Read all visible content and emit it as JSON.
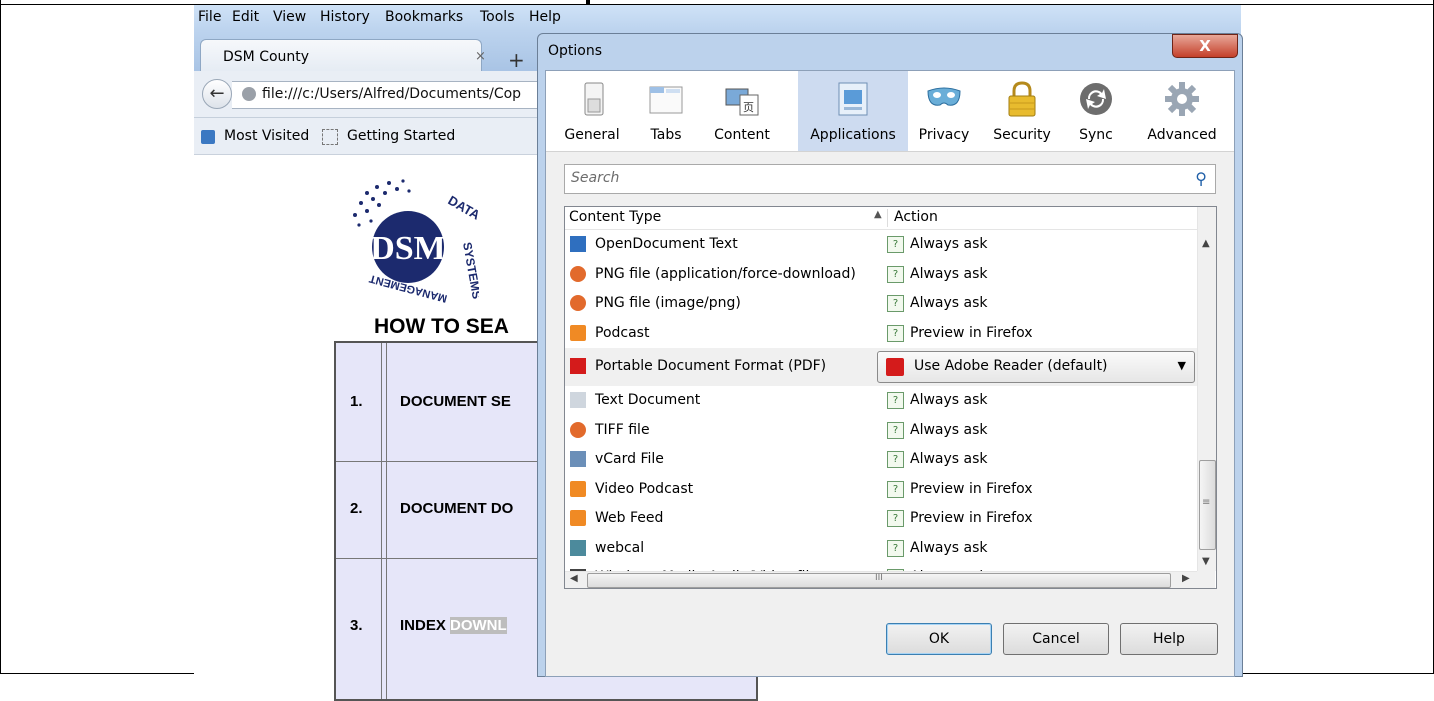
{
  "menubar": {
    "items": [
      "File",
      "Edit",
      "View",
      "History",
      "Bookmarks",
      "Tools",
      "Help"
    ]
  },
  "tab": {
    "title": "DSM County",
    "close": "×",
    "new": "+"
  },
  "navbar": {
    "back": "←",
    "url": "file:///c:/Users/Alfred/Documents/Cop"
  },
  "bookmarks": {
    "most_visited": "Most Visited",
    "getting_started": "Getting Started"
  },
  "page": {
    "heading": "HOW TO SEA",
    "steps": [
      {
        "num": "1.",
        "text": "DOCUMENT SE"
      },
      {
        "num": "2.",
        "text": "DOCUMENT DO"
      },
      {
        "num": "3.",
        "text_a": "INDEX ",
        "text_b": "DOWNL"
      }
    ]
  },
  "dialog": {
    "title": "Options",
    "close": "X",
    "toolbar": [
      {
        "label": "General",
        "icon": "switch-icon"
      },
      {
        "label": "Tabs",
        "icon": "tabs-icon"
      },
      {
        "label": "Content",
        "icon": "content-icon"
      },
      {
        "label": "Applications",
        "icon": "applications-icon"
      },
      {
        "label": "Privacy",
        "icon": "mask-icon"
      },
      {
        "label": "Security",
        "icon": "padlock-icon"
      },
      {
        "label": "Sync",
        "icon": "sync-icon"
      },
      {
        "label": "Advanced",
        "icon": "gear-icon"
      }
    ],
    "active_tab": "Applications",
    "search": {
      "placeholder": "Search",
      "icon": "⚲"
    },
    "columns": {
      "content_type": "Content Type",
      "action": "Action",
      "sort_glyph": "▲"
    },
    "rows": [
      {
        "name": "OpenDocument Text",
        "action": "Always ask",
        "icon": "document-icon"
      },
      {
        "name": "PNG file (application/force-download)",
        "action": "Always ask",
        "icon": "image-icon"
      },
      {
        "name": "PNG file (image/png)",
        "action": "Always ask",
        "icon": "image-icon"
      },
      {
        "name": "Podcast",
        "action": "Preview in Firefox",
        "icon": "rss-icon"
      },
      {
        "name": "Portable Document Format (PDF)",
        "action": "Use Adobe Reader  (default)",
        "icon": "pdf-icon",
        "selected": true
      },
      {
        "name": "Text Document",
        "action": "Always ask",
        "icon": "text-file-icon"
      },
      {
        "name": "TIFF file",
        "action": "Always ask",
        "icon": "image-icon"
      },
      {
        "name": "vCard File",
        "action": "Always ask",
        "icon": "vcard-icon"
      },
      {
        "name": "Video Podcast",
        "action": "Preview in Firefox",
        "icon": "rss-icon"
      },
      {
        "name": "Web Feed",
        "action": "Preview in Firefox",
        "icon": "rss-icon"
      },
      {
        "name": "webcal",
        "action": "Always ask",
        "icon": "calendar-icon"
      },
      {
        "name": "Windows Media Audio/Video file",
        "action": "Always ask",
        "icon": "media-icon"
      }
    ],
    "scroll_glyphs": {
      "up": "▲",
      "down": "▼",
      "left": "◀",
      "right": "▶",
      "grip_v": "≡",
      "grip_h": "III"
    },
    "buttons": {
      "ok": "OK",
      "cancel": "Cancel",
      "help": "Help"
    }
  },
  "colors": {
    "active_tab_bg": "#cddbf0",
    "title_bar": "#bcd2ec",
    "close_red": "#c4402a",
    "pdf_red": "#d41b1b",
    "rss_orange": "#f08a24"
  }
}
